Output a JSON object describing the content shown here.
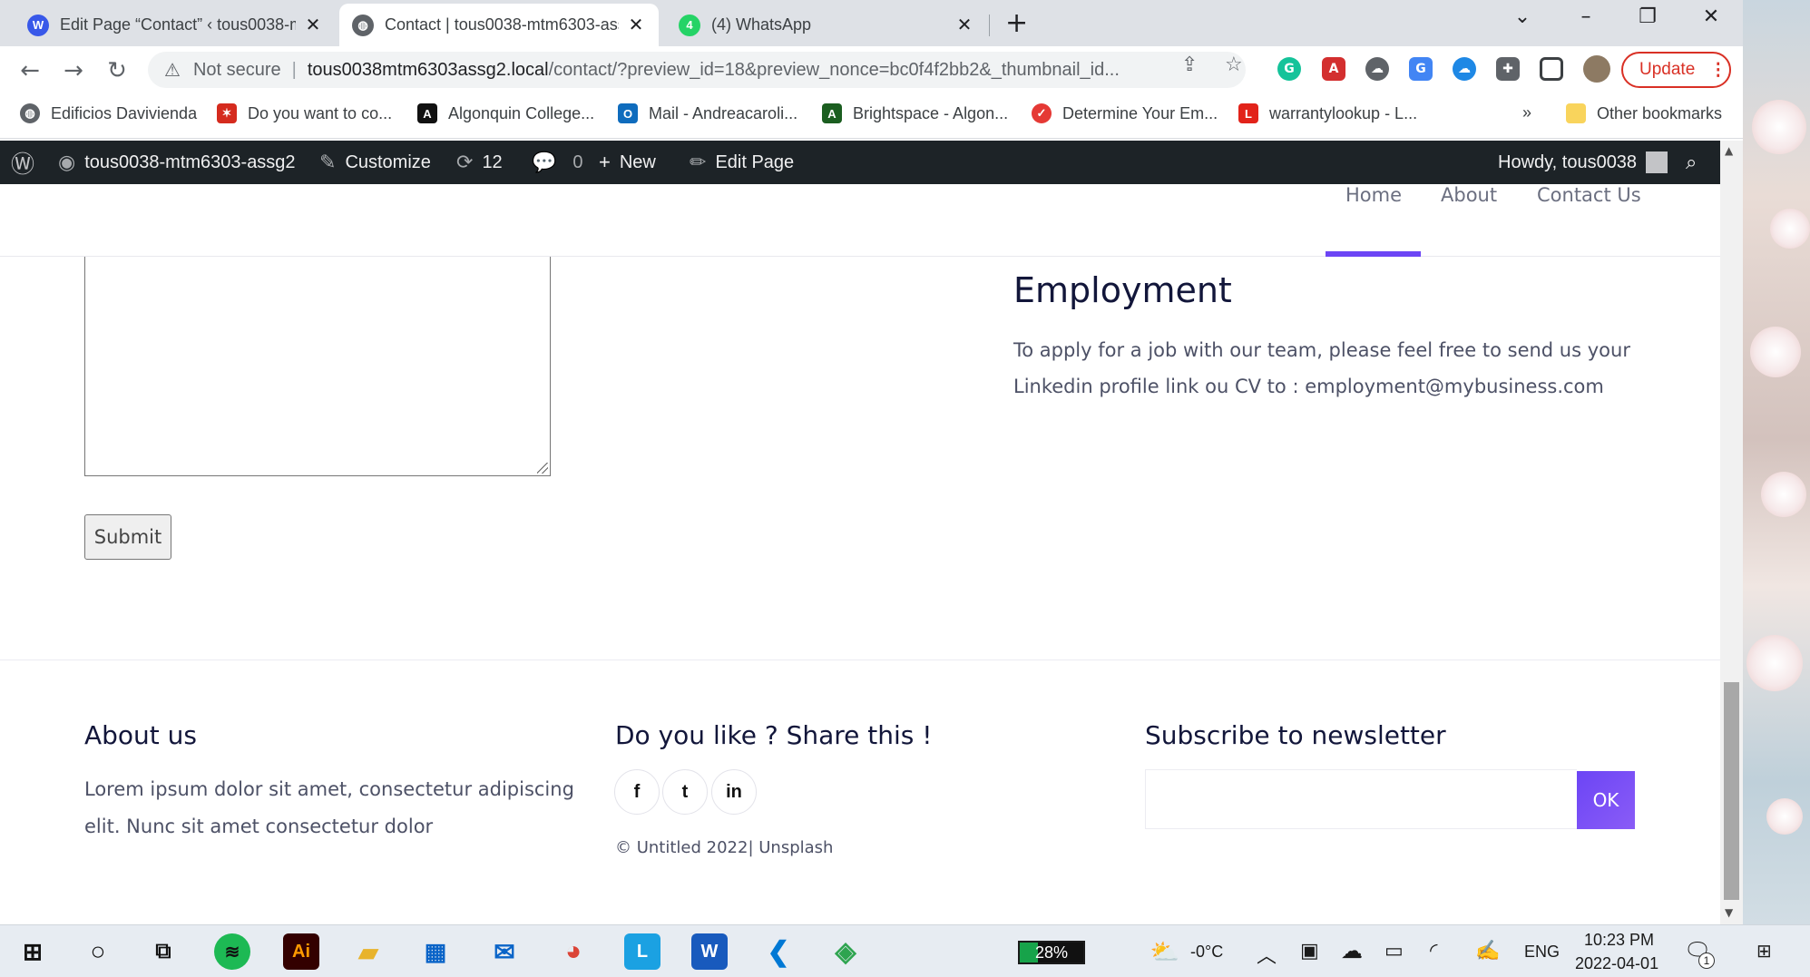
{
  "tabs": [
    {
      "title": "Edit Page “Contact” ‹ tous0038-m",
      "favicon": "wordpress-icon"
    },
    {
      "title": "Contact | tous0038-mtm6303-ass",
      "favicon": "globe-icon"
    },
    {
      "title": "(4) WhatsApp",
      "favicon": "whatsapp-icon"
    }
  ],
  "address": {
    "security_label": "Not secure",
    "host": "tous0038mtm6303assg2.local",
    "path": "/contact/?preview_id=18&preview_nonce=bc0f4f2bb2&_thumbnail_id..."
  },
  "update_button": "Update",
  "bookmarks": [
    "Edificios Davivienda",
    "Do you want to co...",
    "Algonquin College...",
    "Mail - Andreacaroli...",
    "Brightspace - Algon...",
    "Determine Your Em...",
    "warrantylookup - L...",
    "Other bookmarks"
  ],
  "bookmarks_overflow": "»",
  "admin_bar": {
    "site": "tous0038-mtm6303-assg2",
    "customize": "Customize",
    "updates": "12",
    "comments": "0",
    "new": "New",
    "edit": "Edit Page",
    "howdy": "Howdy, tous0038"
  },
  "site_nav": [
    "Home",
    "About",
    "Contact Us"
  ],
  "form": {
    "submit": "Submit"
  },
  "employment": {
    "title": "Employment",
    "text": "To apply for a job with our team, please feel free to send us your Linkedin profile link ou CV to : employment@mybusiness.com"
  },
  "footer": {
    "about_title": "About us",
    "about_text": "Lorem ipsum dolor sit amet, consectetur adipiscing elit. Nunc sit amet consectetur dolor",
    "share_title": "Do you like ? Share this !",
    "social": [
      "f",
      "t",
      "in"
    ],
    "copyright": "© Untitled 2022| Unsplash",
    "newsletter_title": "Subscribe to newsletter",
    "newsletter_button": "OK"
  },
  "taskbar": {
    "battery": "28%",
    "battery_level": 0.28,
    "weather": "-0°C",
    "language": "ENG",
    "time": "10:23 PM",
    "date": "2022-04-01",
    "notifications": "1"
  },
  "colors": {
    "accent": "#6c45f5",
    "admin_bar": "#1d2327",
    "update_red": "#d93025"
  }
}
